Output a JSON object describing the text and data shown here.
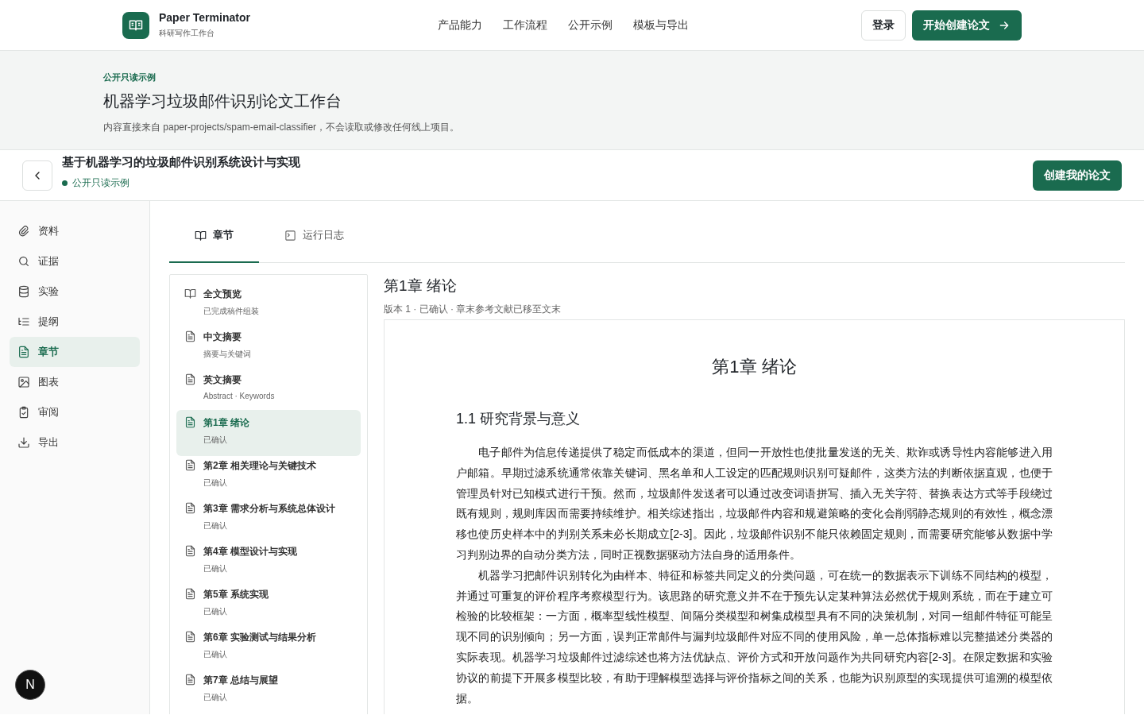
{
  "header": {
    "brand": {
      "name": "Paper Terminator",
      "tagline": "科研写作工作台"
    },
    "nav": [
      "产品能力",
      "工作流程",
      "公开示例",
      "模板与导出"
    ],
    "login": "登录",
    "cta": "开始创建论文"
  },
  "banner": {
    "eyebrow": "公开只读示例",
    "title": "机器学习垃圾邮件识别论文工作台",
    "description": "内容直接来自 paper-projects/spam-email-classifier，不会读取或修改任何线上项目。"
  },
  "project": {
    "title": "基于机器学习的垃圾邮件识别系统设计与实现",
    "status": "公开只读示例",
    "action": "创建我的论文"
  },
  "sidebar": {
    "items": [
      {
        "label": "资料",
        "selected": false
      },
      {
        "label": "证据",
        "selected": false
      },
      {
        "label": "实验",
        "selected": false
      },
      {
        "label": "提纲",
        "selected": false
      },
      {
        "label": "章节",
        "selected": true
      },
      {
        "label": "图表",
        "selected": false
      },
      {
        "label": "审阅",
        "selected": false
      },
      {
        "label": "导出",
        "selected": false
      }
    ]
  },
  "tabs": [
    {
      "label": "章节",
      "selected": true
    },
    {
      "label": "运行日志",
      "selected": false
    }
  ],
  "chapters": [
    {
      "kind": "preview",
      "title": "全文预览",
      "subtitle": "已完成稿件组装",
      "selected": false
    },
    {
      "kind": "section",
      "title": "中文摘要",
      "subtitle": "摘要与关键词",
      "selected": false
    },
    {
      "kind": "section",
      "title": "英文摘要",
      "subtitle": "Abstract · Keywords",
      "selected": false
    },
    {
      "kind": "section",
      "title": "第1章 绪论",
      "subtitle": "已确认",
      "selected": true
    },
    {
      "kind": "section",
      "title": "第2章 相关理论与关键技术",
      "subtitle": "已确认",
      "selected": false
    },
    {
      "kind": "section",
      "title": "第3章 需求分析与系统总体设计",
      "subtitle": "已确认",
      "selected": false
    },
    {
      "kind": "section",
      "title": "第4章 模型设计与实现",
      "subtitle": "已确认",
      "selected": false
    },
    {
      "kind": "section",
      "title": "第5章 系统实现",
      "subtitle": "已确认",
      "selected": false
    },
    {
      "kind": "section",
      "title": "第6章 实验测试与结果分析",
      "subtitle": "已确认",
      "selected": false
    },
    {
      "kind": "section",
      "title": "第7章 总结与展望",
      "subtitle": "已确认",
      "selected": false
    }
  ],
  "document": {
    "title": "第1章 绪论",
    "meta": "版本 1 · 已确认 · 章末参考文献已移至文末",
    "paper": {
      "heading": "第1章 绪论",
      "section": "1.1 研究背景与意义",
      "paragraphs": [
        "电子邮件为信息传递提供了稳定而低成本的渠道，但同一开放性也使批量发送的无关、欺诈或诱导性内容能够进入用户邮箱。早期过滤系统通常依靠关键词、黑名单和人工设定的匹配规则识别可疑邮件，这类方法的判断依据直观，也便于管理员针对已知模式进行干预。然而，垃圾邮件发送者可以通过改变词语拼写、插入无关字符、替换表达方式等手段绕过既有规则，规则库因而需要持续维护。相关综述指出，垃圾邮件内容和规避策略的变化会削弱静态规则的有效性，概念漂移也使历史样本中的判别关系未必长期成立[2-3]。因此，垃圾邮件识别不能只依赖固定规则，而需要研究能够从数据中学习判别边界的自动分类方法，同时正视数据驱动方法自身的适用条件。",
        "机器学习把邮件识别转化为由样本、特征和标签共同定义的分类问题，可在统一的数据表示下训练不同结构的模型，并通过可重复的评价程序考察模型行为。该思路的研究意义并不在于预先认定某种算法必然优于规则系统，而在于建立可检验的比较框架：一方面，概率型线性模型、间隔分类模型和树集成模型具有不同的决策机制，对同一组邮件特征可能呈现不同的识别倾向；另一方面，误判正常邮件与漏判垃圾邮件对应不同的使用风险，单一总体指标难以完整描述分类器的实际表现。机器学习垃圾邮件过滤综述也将方法优缺点、评价方式和开放问题作为共同研究内容[2-3]。在限定数据和实验协议的前提下开展多模型比较，有助于理解模型选择与评价指标之间的关系，也能为识别原型的实现提供可追溯的模型依据。"
      ]
    }
  },
  "dev_badge": "N"
}
